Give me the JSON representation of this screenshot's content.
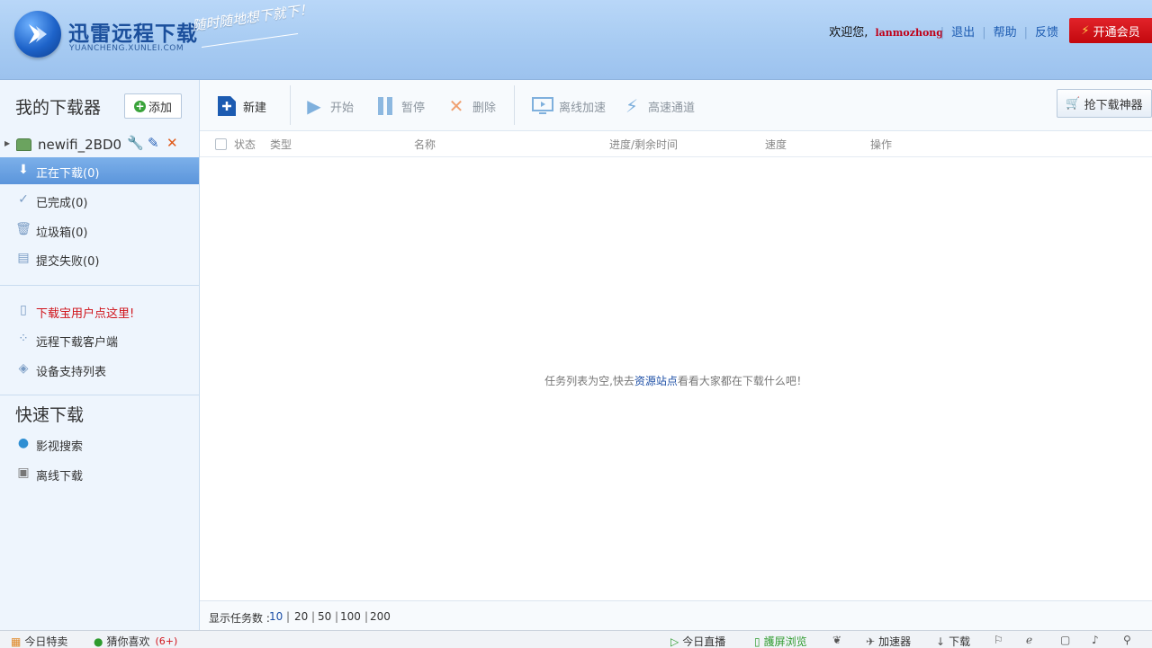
{
  "header": {
    "brand_title": "迅雷远程下载",
    "brand_sub": "YUANCHENG.XUNLEI.COM",
    "slogan": "随时随地想下就下！",
    "welcome": "欢迎您,",
    "username": "lanmozhong",
    "links": [
      "退出",
      "帮助",
      "反馈"
    ],
    "vip_label": "开通会员"
  },
  "sidebar": {
    "title": "我的下载器",
    "add_label": "添加",
    "device_name": "newifi_2BD0",
    "nav": [
      {
        "label": "正在下载(0)",
        "icon": "download-arrow-icon",
        "active": true
      },
      {
        "label": "已完成(0)",
        "icon": "check-icon",
        "active": false
      },
      {
        "label": "垃圾箱(0)",
        "icon": "trash-icon",
        "active": false
      },
      {
        "label": "提交失败(0)",
        "icon": "failed-doc-icon",
        "active": false
      }
    ],
    "links": [
      {
        "label": "下载宝用户点这里!",
        "icon": "document-icon",
        "promo": true
      },
      {
        "label": "远程下载客户端",
        "icon": "grid-icon",
        "promo": false
      },
      {
        "label": "设备支持列表",
        "icon": "layers-icon",
        "promo": false
      }
    ],
    "quick_title": "快速下载",
    "quick": [
      {
        "label": "影视搜索",
        "icon": "globe-icon"
      },
      {
        "label": "离线下载",
        "icon": "offline-icon"
      }
    ]
  },
  "toolbar": {
    "new": "新建",
    "start": "开始",
    "pause": "暂停",
    "delete": "删除",
    "offline_accel": "离线加速",
    "high_speed": "高速通道",
    "grab": "抢下载神器"
  },
  "table": {
    "columns": [
      "状态",
      "类型",
      "名称",
      "进度/剩余时间",
      "速度",
      "操作"
    ]
  },
  "content": {
    "empty_prefix": "任务列表为空,快去",
    "empty_link": "资源站点",
    "empty_suffix": "看看大家都在下载什么吧！"
  },
  "pager": {
    "label": "显示任务数 :",
    "options": [
      "10",
      "20",
      "50",
      "100",
      "200"
    ],
    "current": "10"
  },
  "statusbar": {
    "left": [
      {
        "label": "今日特卖"
      },
      {
        "label": "猜你喜欢",
        "count": "(6+)"
      }
    ],
    "right": [
      {
        "label": "今日直播"
      },
      {
        "label": "護屏浏览"
      },
      {
        "label": "加速器"
      },
      {
        "label": "下载"
      }
    ]
  },
  "colors": {
    "header_bg": "#a7cbf2",
    "active_nav": "#5b95db",
    "vip_red": "#d0141b",
    "link_blue": "#1d4fa6"
  }
}
